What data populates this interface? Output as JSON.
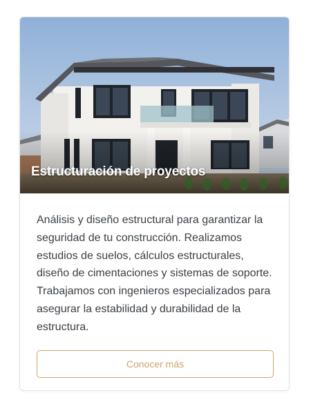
{
  "card": {
    "title": "Estructuración de proyectos",
    "description": "Análisis y diseño estructural para garantizar la seguridad de tu construcción. Realizamos estudios de suelos, cálculos estructurales, diseño de cimentaciones y sistemas de soporte. Trabajamos con ingenieros especializados para asegurar la estabilidad y durabilidad de la estructura.",
    "button_label": "Conocer más",
    "image": "modern-two-story-house-photo"
  },
  "colors": {
    "accent": "#c9a46a",
    "text": "#3a3f44",
    "border": "#e3e3e3"
  }
}
